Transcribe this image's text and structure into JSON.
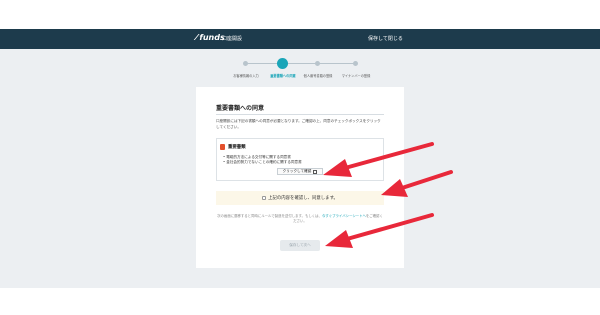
{
  "header": {
    "logo_text": "funds",
    "logo_sub": "口座開設",
    "save_close_label": "保存して閉じる"
  },
  "stepper": {
    "steps": [
      {
        "label": "お客様情報の入力",
        "active": false
      },
      {
        "label": "重要書類への同意",
        "active": true
      },
      {
        "label": "個人番号書類の登録",
        "active": false
      },
      {
        "label": "マイナンバーの登録",
        "active": false
      }
    ]
  },
  "card": {
    "title": "重要書類への同意",
    "intro": "口座開設には下記の書類への同意が必要となります。ご確認の上、同意のチェックボックスをクリックしてください。",
    "documents": {
      "title": "重要書類",
      "items": [
        "電磁的方法による交付等に関する同意書",
        "金社会的勢力でないことの確約に関する同意書"
      ],
      "confirm_label": "クリックして確認"
    },
    "agree_label": "上記の内容を確認し、同意します。",
    "note_text": "次の画面に遷移すると同時にルールで製造を送付します。もしくは、",
    "note_link": "今すぐプライバシーシートへ",
    "note_tail": "をご確認ください。",
    "next_label": "保存して次へ"
  },
  "colors": {
    "header_bg": "#1d3b4c",
    "accent": "#1aa5b8",
    "arrow": "#e8283a",
    "agree_bg": "#fcf7e8"
  }
}
